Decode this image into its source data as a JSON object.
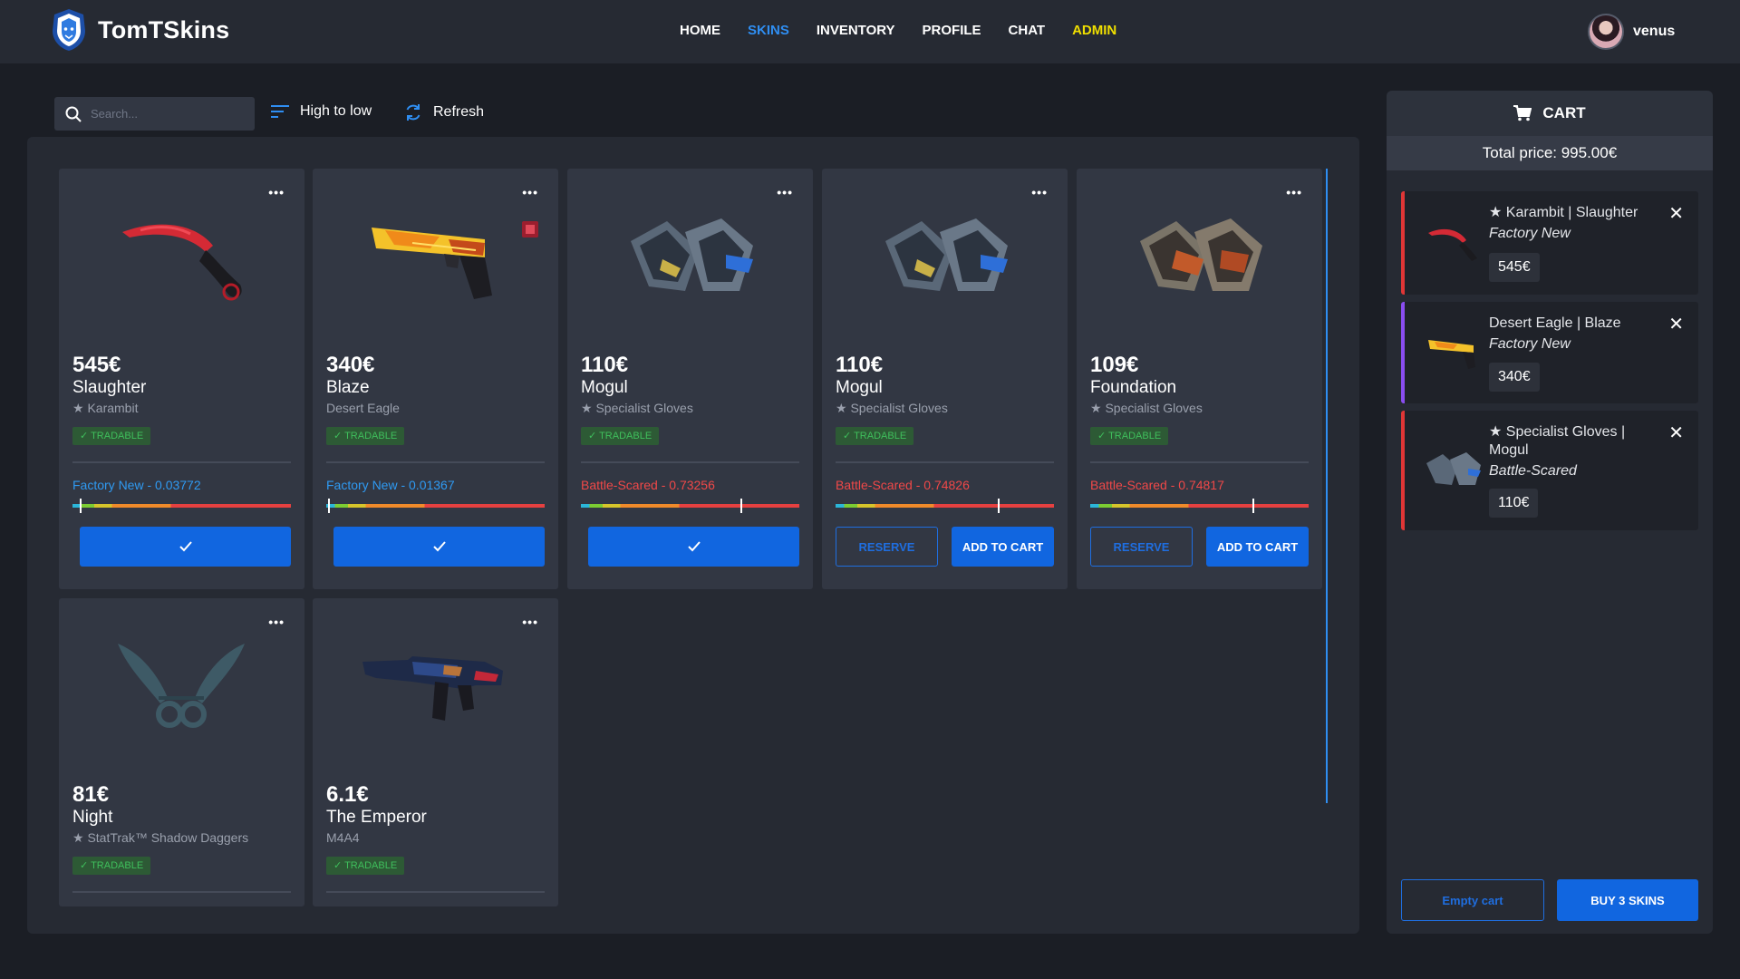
{
  "brand": {
    "name": "TomTSkins",
    "icon": "lion-logo-icon"
  },
  "nav": {
    "home": "HOME",
    "skins": "SKINS",
    "inventory": "INVENTORY",
    "profile": "PROFILE",
    "chat": "CHAT",
    "admin": "ADMIN",
    "active_color": "#2f8ef2",
    "admin_color": "#f0df00"
  },
  "user": {
    "name": "venus"
  },
  "toolbar": {
    "search_placeholder": "Search...",
    "sort_label": "High to low",
    "refresh_label": "Refresh"
  },
  "cards": [
    {
      "price": "545€",
      "skin": "Slaughter",
      "weapon": "★ Karambit",
      "tradable": "TRADABLE",
      "float": "Factory New - 0.03772",
      "float_value": 0.03772,
      "action": "check"
    },
    {
      "price": "340€",
      "skin": "Blaze",
      "weapon": "Desert Eagle",
      "tradable": "TRADABLE",
      "float": "Factory New - 0.01367",
      "float_value": 0.01367,
      "action": "check"
    },
    {
      "price": "110€",
      "skin": "Mogul",
      "weapon": "★ Specialist Gloves",
      "tradable": "TRADABLE",
      "float": "Battle-Scared - 0.73256",
      "float_value": 0.73256,
      "action": "check"
    },
    {
      "price": "110€",
      "skin": "Mogul",
      "weapon": "★ Specialist Gloves",
      "tradable": "TRADABLE",
      "float": "Battle-Scared - 0.74826",
      "float_value": 0.74826,
      "action": "buttons",
      "reserve": "RESERVE",
      "add": "ADD TO CART"
    },
    {
      "price": "109€",
      "skin": "Foundation",
      "weapon": "★ Specialist Gloves",
      "tradable": "TRADABLE",
      "float": "Battle-Scared - 0.74817",
      "float_value": 0.74817,
      "action": "buttons",
      "reserve": "RESERVE",
      "add": "ADD TO CART"
    },
    {
      "price": "81€",
      "skin": "Night",
      "weapon": "★ StatTrak™ Shadow Daggers",
      "tradable": "TRADABLE"
    },
    {
      "price": "6.1€",
      "skin": "The Emperor",
      "weapon": "M4A4",
      "tradable": "TRADABLE"
    }
  ],
  "cart": {
    "title": "CART",
    "total": "Total price: 995.00€",
    "items": [
      {
        "name": "★ Karambit | Slaughter",
        "condition": "Factory New",
        "price": "545€"
      },
      {
        "name": "Desert Eagle | Blaze",
        "condition": "Factory New",
        "price": "340€"
      },
      {
        "name": "★ Specialist Gloves | Mogul",
        "condition": "Battle-Scared",
        "price": "110€"
      }
    ],
    "empty_label": "Empty cart",
    "buy_label": "BUY 3 SKINS"
  }
}
